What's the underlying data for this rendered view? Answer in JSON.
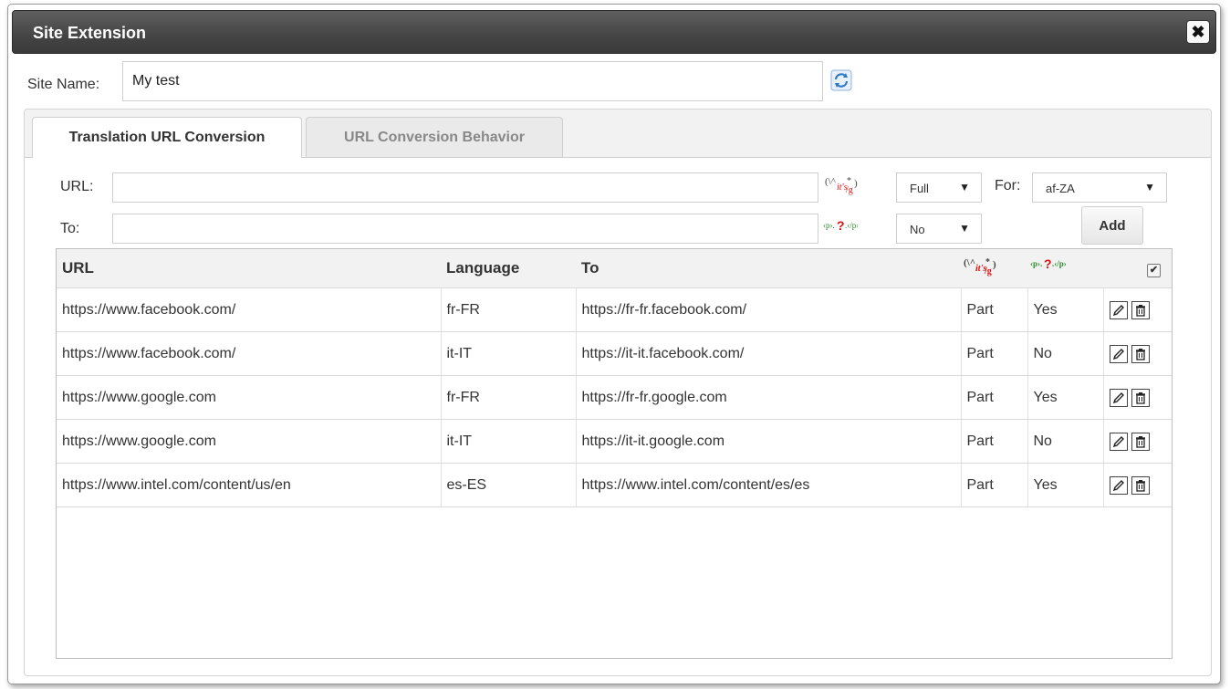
{
  "dialog": {
    "title": "Site Extension",
    "close_glyph": "✖"
  },
  "site": {
    "label": "Site Name:",
    "value": "My test"
  },
  "tabs": [
    {
      "label": "Translation URL Conversion",
      "active": true
    },
    {
      "label": "URL Conversion Behavior",
      "active": false
    }
  ],
  "form": {
    "url_label": "URL:",
    "to_label": "To:",
    "match_select": "Full",
    "for_label": "For:",
    "lang_select": "af-ZA",
    "html_select": "No",
    "add_label": "Add"
  },
  "table": {
    "columns": [
      "URL",
      "Language",
      "To"
    ],
    "header_check": "✔",
    "rows": [
      {
        "url": "https://www.facebook.com/",
        "language": "fr-FR",
        "to": "https://fr-fr.facebook.com/",
        "match": "Part",
        "html": "Yes"
      },
      {
        "url": "https://www.facebook.com/",
        "language": "it-IT",
        "to": "https://it-it.facebook.com/",
        "match": "Part",
        "html": "No"
      },
      {
        "url": "https://www.google.com",
        "language": "fr-FR",
        "to": "https://fr-fr.google.com",
        "match": "Part",
        "html": "Yes"
      },
      {
        "url": "https://www.google.com",
        "language": "it-IT",
        "to": "https://it-it.google.com",
        "match": "Part",
        "html": "No"
      },
      {
        "url": "https://www.intel.com/content/us/en",
        "language": "es-ES",
        "to": "https://www.intel.com/content/es/es",
        "match": "Part",
        "html": "Yes"
      }
    ]
  },
  "icons": {
    "refresh": "refresh-icon",
    "regex": "regex-icon",
    "html_tag": "html-question-icon",
    "edit": "pencil-icon",
    "delete": "trash-icon"
  }
}
